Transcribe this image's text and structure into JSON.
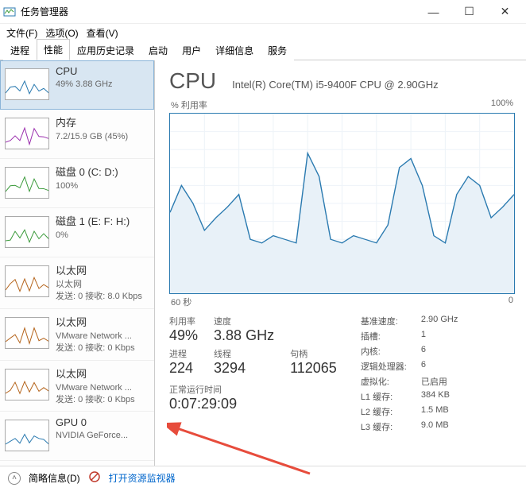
{
  "window": {
    "title": "任务管理器",
    "minimize": "—",
    "maximize": "☐",
    "close": "✕"
  },
  "menu": {
    "file": "文件(F)",
    "options": "选项(O)",
    "view": "查看(V)"
  },
  "tabs": {
    "processes": "进程",
    "performance": "性能",
    "app_history": "应用历史记录",
    "startup": "启动",
    "users": "用户",
    "details": "详细信息",
    "services": "服务"
  },
  "sidebar": {
    "items": [
      {
        "title": "CPU",
        "sub1": "49% 3.88 GHz",
        "sub2": "",
        "color": "#2a7ab0"
      },
      {
        "title": "内存",
        "sub1": "7.2/15.9 GB (45%)",
        "sub2": "",
        "color": "#9b2fae"
      },
      {
        "title": "磁盘 0 (C: D:)",
        "sub1": "100%",
        "sub2": "",
        "color": "#3a9a3a"
      },
      {
        "title": "磁盘 1 (E: F: H:)",
        "sub1": "0%",
        "sub2": "",
        "color": "#3a9a3a"
      },
      {
        "title": "以太网",
        "sub1": "以太网",
        "sub2": "发送: 0 接收: 8.0 Kbps",
        "color": "#b5651d"
      },
      {
        "title": "以太网",
        "sub1": "VMware Network ...",
        "sub2": "发送: 0 接收: 0 Kbps",
        "color": "#b5651d"
      },
      {
        "title": "以太网",
        "sub1": "VMware Network ...",
        "sub2": "发送: 0 接收: 0 Kbps",
        "color": "#b5651d"
      },
      {
        "title": "GPU 0",
        "sub1": "NVIDIA GeForce...",
        "sub2": "",
        "color": "#2a7ab0"
      }
    ]
  },
  "detail": {
    "title": "CPU",
    "model": "Intel(R) Core(TM) i5-9400F CPU @ 2.90GHz",
    "chart_top_left": "% 利用率",
    "chart_top_right": "100%",
    "chart_bottom_left": "60 秒",
    "chart_bottom_right": "0",
    "stats_primary": [
      {
        "label": "利用率",
        "value": "49%"
      },
      {
        "label": "速度",
        "value": "3.88 GHz"
      },
      {
        "label": "",
        "value": ""
      },
      {
        "label": "进程",
        "value": "224"
      },
      {
        "label": "线程",
        "value": "3294"
      },
      {
        "label": "句柄",
        "value": "112065"
      }
    ],
    "uptime_label": "正常运行时间",
    "uptime_value": "0:07:29:09",
    "stats_secondary": [
      {
        "label": "基准速度:",
        "value": "2.90 GHz"
      },
      {
        "label": "插槽:",
        "value": "1"
      },
      {
        "label": "内核:",
        "value": "6"
      },
      {
        "label": "逻辑处理器:",
        "value": "6"
      },
      {
        "label": "虚拟化:",
        "value": "已启用"
      },
      {
        "label": "L1 缓存:",
        "value": "384 KB"
      },
      {
        "label": "L2 缓存:",
        "value": "1.5 MB"
      },
      {
        "label": "L3 缓存:",
        "value": "9.0 MB"
      }
    ]
  },
  "chart_data": {
    "type": "line",
    "title": "% 利用率",
    "xlabel": "60 秒",
    "ylabel": "% 利用率",
    "ylim": [
      0,
      100
    ],
    "x_seconds_ago": [
      60,
      58,
      56,
      54,
      52,
      50,
      48,
      46,
      44,
      42,
      40,
      38,
      36,
      34,
      32,
      30,
      28,
      26,
      24,
      22,
      20,
      18,
      16,
      14,
      12,
      10,
      8,
      6,
      4,
      2,
      0
    ],
    "values": [
      45,
      60,
      50,
      35,
      42,
      48,
      55,
      30,
      28,
      32,
      30,
      28,
      78,
      65,
      30,
      28,
      32,
      30,
      28,
      38,
      70,
      75,
      60,
      32,
      28,
      55,
      65,
      60,
      42,
      48,
      55
    ]
  },
  "footer": {
    "brief": "简略信息(D)",
    "resmon": "打开资源监视器"
  }
}
